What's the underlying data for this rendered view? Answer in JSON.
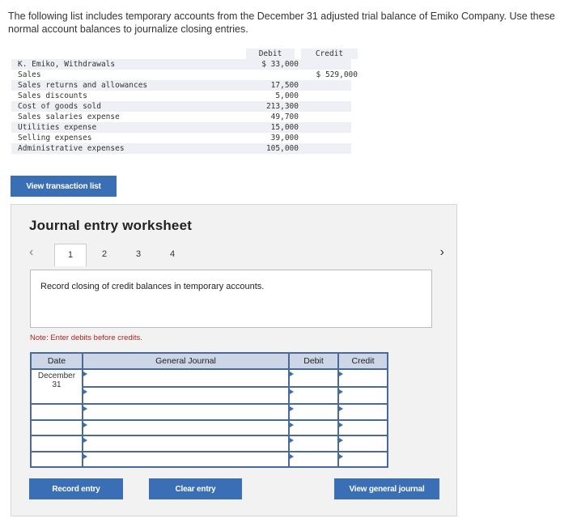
{
  "intro_text": "The following list includes temporary accounts from the December 31 adjusted trial balance of Emiko Company. Use these normal account balances to journalize closing entries.",
  "trial_balance": {
    "debit_header": "Debit",
    "credit_header": "Credit",
    "rows": [
      {
        "account": "K. Emiko, Withdrawals",
        "debit": "$ 33,000",
        "credit": ""
      },
      {
        "account": "Sales",
        "debit": "",
        "credit": "$ 529,000"
      },
      {
        "account": "Sales returns and allowances",
        "debit": "17,500",
        "credit": ""
      },
      {
        "account": "Sales discounts",
        "debit": "5,000",
        "credit": ""
      },
      {
        "account": "Cost of goods sold",
        "debit": "213,300",
        "credit": ""
      },
      {
        "account": "Sales salaries expense",
        "debit": "49,700",
        "credit": ""
      },
      {
        "account": "Utilities expense",
        "debit": "15,000",
        "credit": ""
      },
      {
        "account": "Selling expenses",
        "debit": "39,000",
        "credit": ""
      },
      {
        "account": "Administrative expenses",
        "debit": "105,000",
        "credit": ""
      }
    ]
  },
  "view_transaction_list_label": "View transaction list",
  "worksheet": {
    "title": "Journal entry worksheet",
    "prev_icon": "‹",
    "next_icon": "›",
    "tabs": [
      "1",
      "2",
      "3",
      "4"
    ],
    "active_tab": "1",
    "instruction": "Record closing of credit balances in temporary accounts.",
    "note": "Note: Enter debits before credits.",
    "table": {
      "headers": [
        "Date",
        "General Journal",
        "Debit",
        "Credit"
      ],
      "date_month": "December",
      "date_day": "31",
      "rows": 6
    },
    "record_entry_label": "Record entry",
    "clear_entry_label": "Clear entry",
    "view_general_journal_label": "View general journal"
  },
  "colors": {
    "accent": "#3a6eb5",
    "table_border": "#4a6b9a",
    "header_bg": "#ccd6e6",
    "note": "#b22222"
  }
}
